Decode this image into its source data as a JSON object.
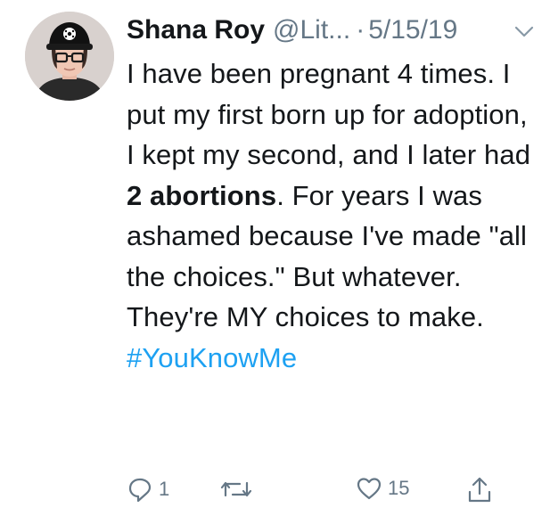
{
  "tweet": {
    "author_name": "Shana Roy",
    "author_handle": "@Lit...",
    "separator": "·",
    "date": "5/15/19",
    "text_intro": "I have been pregnant 4 times. I put my first born up for adoption, I kept my second, and I later had ",
    "text_bold": "2 abortions",
    "text_rest": ". For years I was ashamed because I've made \"all the choices.\" But whatever. They're MY choices to make.",
    "hashtag": "#YouKnowMe"
  },
  "actions": {
    "reply_count": "1",
    "retweet_count": "",
    "like_count": "15"
  },
  "colors": {
    "text": "#14171a",
    "muted": "#657786",
    "link": "#1da1f2"
  },
  "icons": [
    "chevron-down-icon",
    "reply-icon",
    "retweet-icon",
    "like-icon",
    "share-icon"
  ]
}
